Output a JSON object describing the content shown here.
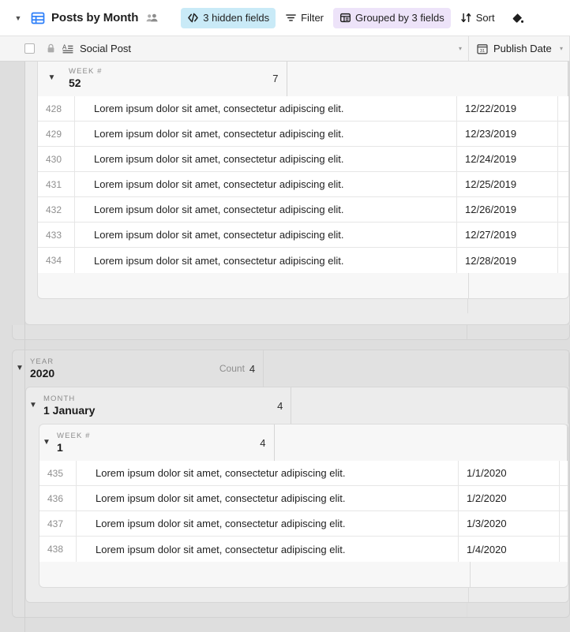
{
  "toolbar": {
    "view_caret": "▼",
    "grid_icon": "grid-view-icon",
    "title": "Posts by Month",
    "collaborators_icon": "collaborators-icon",
    "chips": [
      {
        "id": "hidden-fields",
        "label": "3 hidden fields",
        "icon": "hidden-fields-icon",
        "style": "hidden-fields"
      },
      {
        "id": "filter",
        "label": "Filter",
        "icon": "filter-icon",
        "style": "plain"
      },
      {
        "id": "grouped",
        "label": "Grouped by 3 fields",
        "icon": "group-icon",
        "style": "grouped"
      },
      {
        "id": "sort",
        "label": "Sort",
        "icon": "sort-icon",
        "style": "plain"
      },
      {
        "id": "color",
        "label": "",
        "icon": "paint-bucket-icon",
        "style": "plain"
      }
    ]
  },
  "field_header": {
    "select_all_checkbox": "checkbox-unchecked",
    "lock_icon": "lock-icon",
    "columns": [
      {
        "name": "Social Post",
        "icon": "long-text-icon",
        "caret": "▾"
      },
      {
        "name": "Publish Date",
        "icon": "calendar-icon",
        "caret": "▾"
      }
    ]
  },
  "groups": [
    {
      "id": "group-week-52",
      "level": "week",
      "field_label": "WEEK #",
      "value": "52",
      "count_label": "",
      "count": "7",
      "caret": "▼",
      "clipped_top": true,
      "rows": [
        {
          "num": "428",
          "social_post": "Lorem ipsum dolor sit amet, consectetur adipiscing elit.",
          "publish_date": "12/22/2019"
        },
        {
          "num": "429",
          "social_post": "Lorem ipsum dolor sit amet, consectetur adipiscing elit.",
          "publish_date": "12/23/2019"
        },
        {
          "num": "430",
          "social_post": "Lorem ipsum dolor sit amet, consectetur adipiscing elit.",
          "publish_date": "12/24/2019"
        },
        {
          "num": "431",
          "social_post": "Lorem ipsum dolor sit amet, consectetur adipiscing elit.",
          "publish_date": "12/25/2019"
        },
        {
          "num": "432",
          "social_post": "Lorem ipsum dolor sit amet, consectetur adipiscing elit.",
          "publish_date": "12/26/2019"
        },
        {
          "num": "433",
          "social_post": "Lorem ipsum dolor sit amet, consectetur adipiscing elit.",
          "publish_date": "12/27/2019"
        },
        {
          "num": "434",
          "social_post": "Lorem ipsum dolor sit amet, consectetur adipiscing elit.",
          "publish_date": "12/28/2019"
        }
      ]
    },
    {
      "id": "group-year-2020",
      "level": "year",
      "field_label": "YEAR",
      "value": "2020",
      "count_label": "Count",
      "count": "4",
      "caret": "▼",
      "clipped_top": false,
      "child": {
        "id": "group-month-january",
        "level": "month",
        "field_label": "MONTH",
        "value": "1 January",
        "count_label": "",
        "count": "4",
        "caret": "▼",
        "child": {
          "id": "group-week-1",
          "level": "week",
          "field_label": "WEEK #",
          "value": "1",
          "count_label": "",
          "count": "4",
          "caret": "▼",
          "rows": [
            {
              "num": "435",
              "social_post": "Lorem ipsum dolor sit amet, consectetur adipiscing elit.",
              "publish_date": "1/1/2020"
            },
            {
              "num": "436",
              "social_post": "Lorem ipsum dolor sit amet, consectetur adipiscing elit.",
              "publish_date": "1/2/2020"
            },
            {
              "num": "437",
              "social_post": "Lorem ipsum dolor sit amet, consectetur adipiscing elit.",
              "publish_date": "1/3/2020"
            },
            {
              "num": "438",
              "social_post": "Lorem ipsum dolor sit amet, consectetur adipiscing elit.",
              "publish_date": "1/4/2020"
            }
          ]
        }
      }
    }
  ],
  "colors": {
    "hidden_fields_chip": "#c9eaf7",
    "grouped_chip": "#ede3f9",
    "grid_icon_blue": "#2d7ff9",
    "year_band": "#e1e1e1",
    "month_band": "#ececec",
    "week_band": "#f7f7f7",
    "canvas": "#dedede",
    "row_bg": "#ffffff"
  }
}
